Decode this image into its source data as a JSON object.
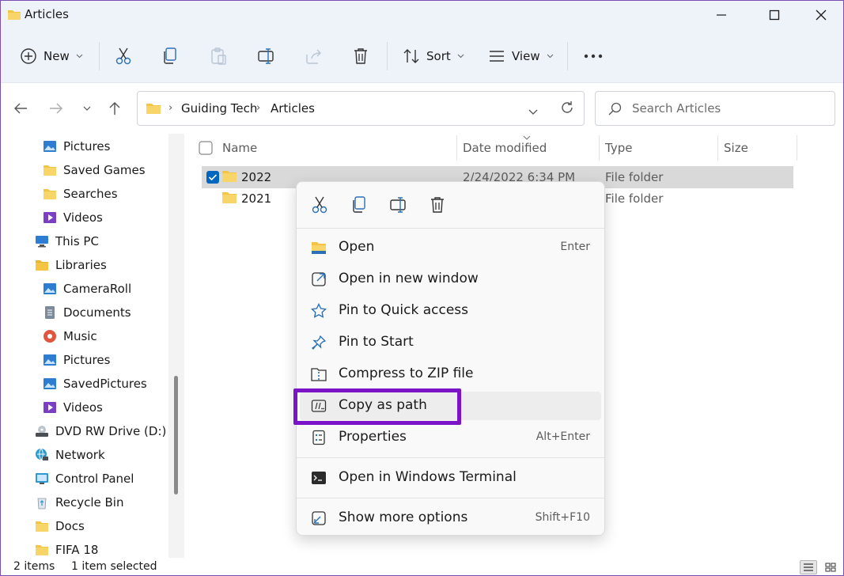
{
  "window": {
    "title": "Articles"
  },
  "toolbar": {
    "new_label": "New",
    "sort_label": "Sort",
    "view_label": "View"
  },
  "address": {
    "crumbs": [
      "Guiding Tech",
      "Articles"
    ]
  },
  "search": {
    "placeholder": "Search Articles"
  },
  "sidebar": {
    "items": [
      {
        "label": "Pictures",
        "icon": "pictures-icon"
      },
      {
        "label": "Saved Games",
        "icon": "folder-icon"
      },
      {
        "label": "Searches",
        "icon": "folder-icon"
      },
      {
        "label": "Videos",
        "icon": "videos-icon"
      },
      {
        "label": "This PC",
        "icon": "this-pc-icon"
      },
      {
        "label": "Libraries",
        "icon": "libraries-icon"
      },
      {
        "label": "CameraRoll",
        "icon": "pictures-icon"
      },
      {
        "label": "Documents",
        "icon": "documents-icon"
      },
      {
        "label": "Music",
        "icon": "music-icon"
      },
      {
        "label": "Pictures",
        "icon": "pictures-icon"
      },
      {
        "label": "SavedPictures",
        "icon": "pictures-icon"
      },
      {
        "label": "Videos",
        "icon": "videos-icon"
      },
      {
        "label": "DVD RW Drive (D:)",
        "icon": "dvd-drive-icon"
      },
      {
        "label": "Network",
        "icon": "network-icon"
      },
      {
        "label": "Control Panel",
        "icon": "control-panel-icon"
      },
      {
        "label": "Recycle Bin",
        "icon": "recycle-bin-icon"
      },
      {
        "label": "Docs",
        "icon": "folder-icon"
      },
      {
        "label": "FIFA 18",
        "icon": "folder-icon"
      }
    ]
  },
  "filelist": {
    "columns": [
      "Name",
      "Date modified",
      "Type",
      "Size"
    ],
    "rows": [
      {
        "name": "2022",
        "date": "2/24/2022 6:34 PM",
        "type": "File folder",
        "selected": true
      },
      {
        "name": "2021",
        "date": "",
        "type": "File folder",
        "selected": false
      }
    ]
  },
  "context_menu": {
    "quick_actions": [
      "cut-icon",
      "copy-icon",
      "rename-icon",
      "delete-icon"
    ],
    "items": [
      {
        "label": "Open",
        "shortcut": "Enter",
        "icon": "folder-open-icon"
      },
      {
        "label": "Open in new window",
        "shortcut": "",
        "icon": "open-new-window-icon"
      },
      {
        "label": "Pin to Quick access",
        "shortcut": "",
        "icon": "star-icon"
      },
      {
        "label": "Pin to Start",
        "shortcut": "",
        "icon": "pin-icon"
      },
      {
        "label": "Compress to ZIP file",
        "shortcut": "",
        "icon": "zip-icon"
      },
      {
        "label": "Copy as path",
        "shortcut": "",
        "icon": "copy-path-icon"
      },
      {
        "label": "Properties",
        "shortcut": "Alt+Enter",
        "icon": "properties-icon"
      },
      {
        "label": "Open in Windows Terminal",
        "shortcut": "",
        "icon": "terminal-icon"
      },
      {
        "label": "Show more options",
        "shortcut": "Shift+F10",
        "icon": "more-options-icon"
      }
    ],
    "highlighted": "Copy as path"
  },
  "status": {
    "items_count": "2 items",
    "selected_count": "1 item selected"
  },
  "colors": {
    "highlight": "#7b14c7",
    "folder": "#f4c542",
    "accent": "#0067c0",
    "selected_row": "#d9d9d9"
  }
}
